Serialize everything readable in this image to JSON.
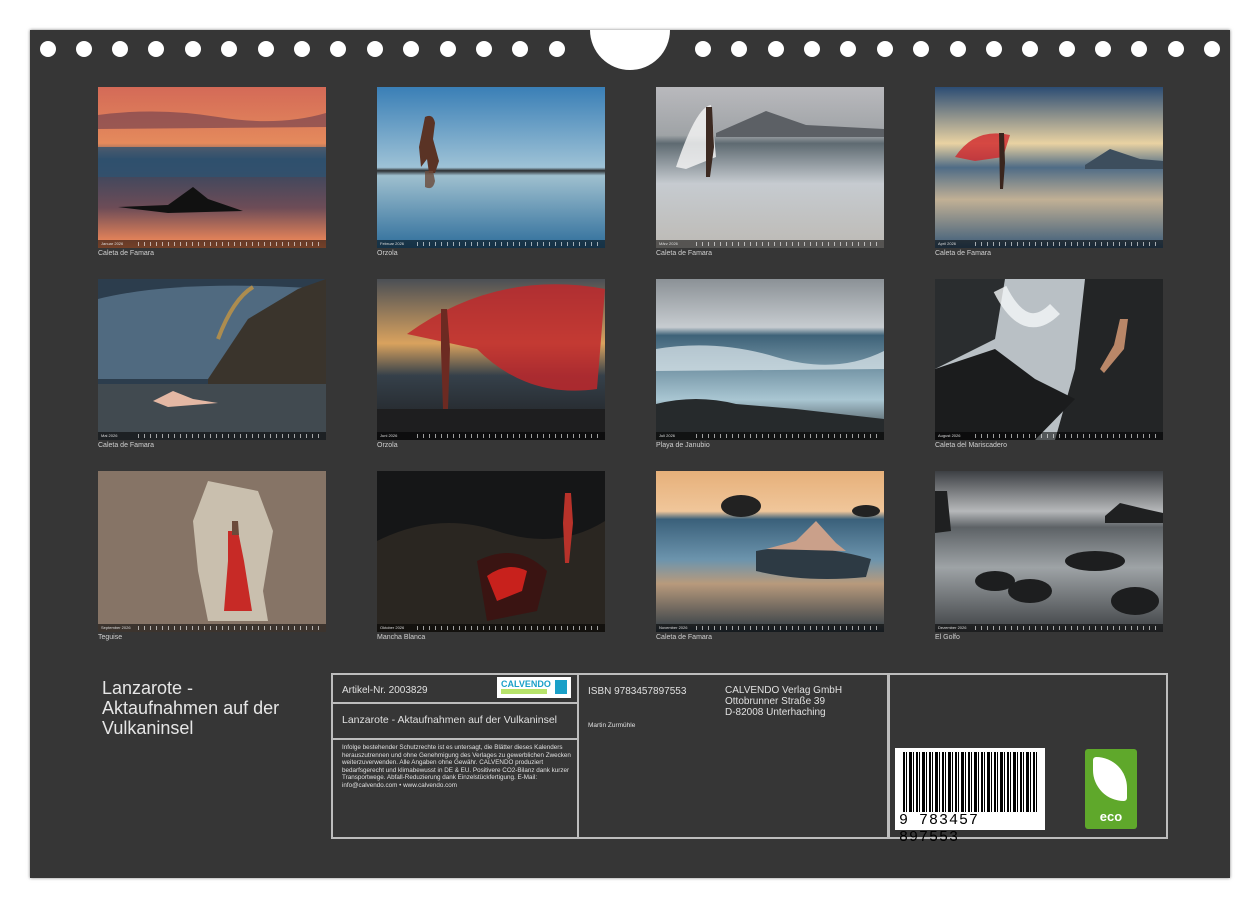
{
  "calendar": {
    "title": "Lanzarote -\nAktaufnahmen auf der\nVulkaninsel",
    "months": [
      {
        "label": "Januar 2026",
        "location": "Caleta de Famara"
      },
      {
        "label": "Februar 2026",
        "location": "Orzola"
      },
      {
        "label": "März 2026",
        "location": "Caleta de Famara"
      },
      {
        "label": "April 2026",
        "location": "Caleta de Famara"
      },
      {
        "label": "Mai 2026",
        "location": "Caleta de Famara"
      },
      {
        "label": "Juni 2026",
        "location": "Orzola"
      },
      {
        "label": "Juli 2026",
        "location": "Playa de Janubio"
      },
      {
        "label": "August 2026",
        "location": "Caleta del Mariscadero"
      },
      {
        "label": "September 2026",
        "location": "Teguise"
      },
      {
        "label": "Oktober 2026",
        "location": "Mancha Blanca"
      },
      {
        "label": "November 2026",
        "location": "Caleta de Famara"
      },
      {
        "label": "Dezember 2026",
        "location": "El Golfo"
      }
    ]
  },
  "info": {
    "article": "Artikel-Nr. 2003829",
    "logo_text": "CALVENDO",
    "short_title": "Lanzarote - Aktaufnahmen auf der Vulkaninsel",
    "legal_text": "Infolge bestehender Schutzrechte ist es untersagt, die Blätter dieses Kalenders herauszutrennen und ohne Genehmigung des Verlages zu gewerblichen Zwecken weiterzuverwenden. Alle Angaben ohne Gewähr. CALVENDO produziert bedarfsgerecht und klimabewusst in DE & EU. Positivere CO2-Bilanz dank kurzer Transportwege. Abfall-Reduzierung dank Einzelstückfertigung. E-Mail: info@calvendo.com • www.calvendo.com",
    "isbn": "ISBN 9783457897553",
    "author": "Martin Zurmühle",
    "publisher": "CALVENDO Verlag GmbH",
    "street": "Ottobrunner Straße 39",
    "city": "D-82008 Unterhaching",
    "barcode_number": "9 783457 897553",
    "eco_label": "eco"
  },
  "colors": {
    "background": "#363636",
    "text": "#e6e6e6",
    "eco_green": "#5fa82b",
    "accent_red": "#d1262b"
  }
}
